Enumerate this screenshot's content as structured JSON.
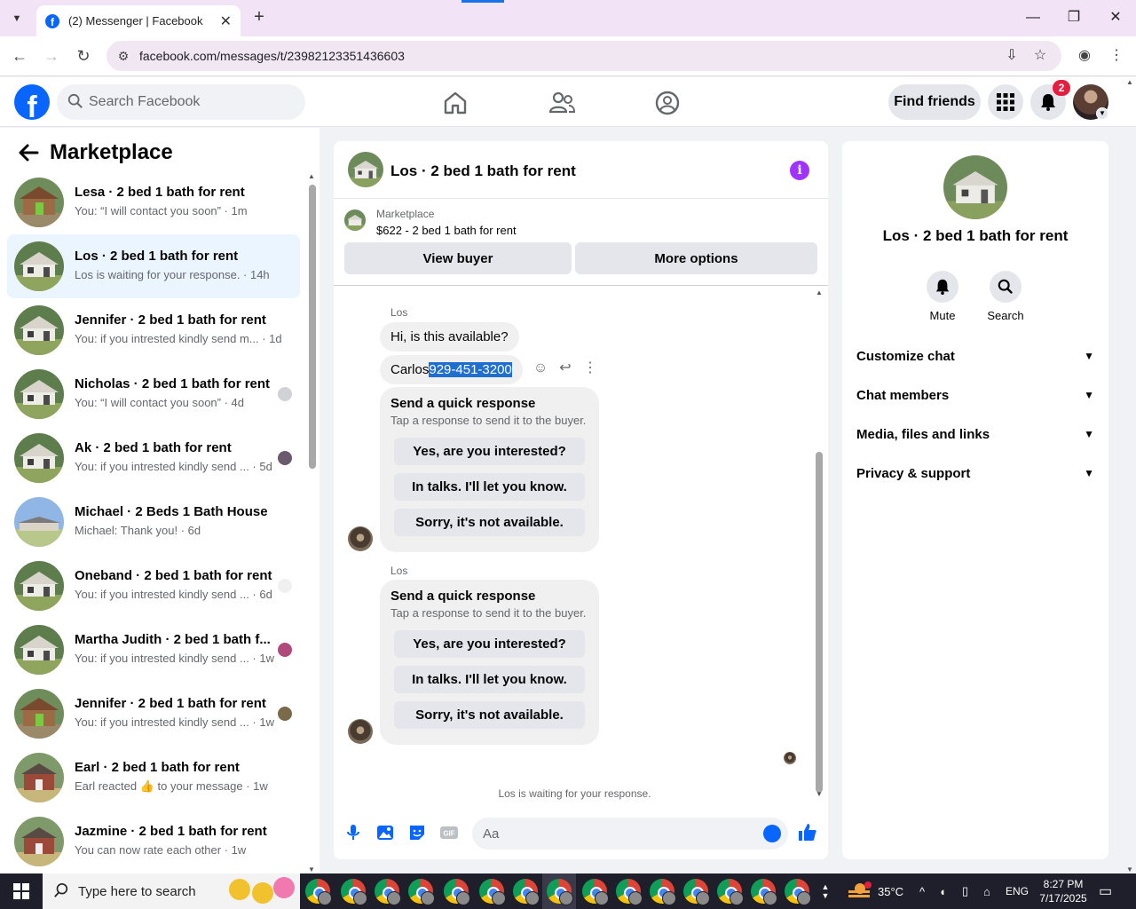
{
  "browser": {
    "tab_title": "(2) Messenger | Facebook",
    "url": "facebook.com/messages/t/23982123351436603"
  },
  "header": {
    "search_placeholder": "Search Facebook",
    "find_friends": "Find friends",
    "notification_count": "2"
  },
  "sidebar": {
    "title": "Marketplace",
    "conversations": [
      {
        "name": "Lesa · 2 bed 1 bath for rent",
        "preview": "You: “I will contact you soon” · 1m",
        "thumb": "cabin"
      },
      {
        "name": "Los · 2 bed 1 bath for rent",
        "preview": "Los is waiting for your response. · 14h",
        "thumb": "house"
      },
      {
        "name": "Jennifer · 2 bed 1 bath for rent",
        "preview": "You: if you intrested kindly send m... · 1d",
        "thumb": "house"
      },
      {
        "name": "Nicholas · 2 bed 1 bath for rent",
        "preview": "You: “I will contact you soon” · 4d",
        "thumb": "house"
      },
      {
        "name": "Ak · 2 bed 1 bath for rent",
        "preview": "You: if you intrested kindly send ... · 5d",
        "thumb": "house"
      },
      {
        "name": "Michael · 2 Beds 1 Bath House",
        "preview": "Michael: Thank you! · 6d",
        "thumb": "sky"
      },
      {
        "name": "Oneband · 2 bed 1 bath for rent",
        "preview": "You: if you intrested kindly send ... · 6d",
        "thumb": "house"
      },
      {
        "name": "Martha Judith · 2 bed 1 bath f...",
        "preview": "You: if you intrested kindly send ... · 1w",
        "thumb": "house"
      },
      {
        "name": "Jennifer · 2 bed 1 bath for rent",
        "preview": "You: if you intrested kindly send ... · 1w",
        "thumb": "cabin"
      },
      {
        "name": "Earl · 2 bed 1 bath for rent",
        "preview": "Earl reacted 👍 to your message · 1w",
        "thumb": "brick"
      },
      {
        "name": "Jazmine · 2 bed 1 bath for rent",
        "preview": "You can now rate each other · 1w",
        "thumb": "brick"
      }
    ]
  },
  "chat": {
    "title": "Los · 2 bed 1 bath for rent",
    "listing_source": "Marketplace",
    "listing_desc": "$622 - 2 bed 1 bath for rent",
    "view_buyer": "View buyer",
    "more_options": "More options",
    "sender": "Los",
    "msg1": "Hi, is this available?",
    "msg2_prefix": "Carlos",
    "msg2_selected": "929-451-3200",
    "quick": {
      "title": "Send a quick response",
      "subtitle": "Tap a response to send it to the buyer.",
      "options": [
        "Yes, are you interested?",
        "In talks. I'll let you know.",
        "Sorry, it's not available."
      ]
    },
    "waiting": "Los is waiting for your response.",
    "composer_placeholder": "Aa"
  },
  "info_panel": {
    "name": "Los · 2 bed 1 bath for rent",
    "mute": "Mute",
    "search": "Search",
    "sections": [
      "Customize chat",
      "Chat members",
      "Media, files and links",
      "Privacy & support"
    ]
  },
  "taskbar": {
    "search_placeholder": "Type here to search",
    "temperature": "35°C",
    "language": "ENG",
    "time": "8:27 PM",
    "date": "7/17/2025"
  },
  "colors": {
    "fb_blue": "#0866ff",
    "info_purple": "#a033ff",
    "notif_red": "#e41e3f",
    "selection": "#1f6fd1"
  }
}
